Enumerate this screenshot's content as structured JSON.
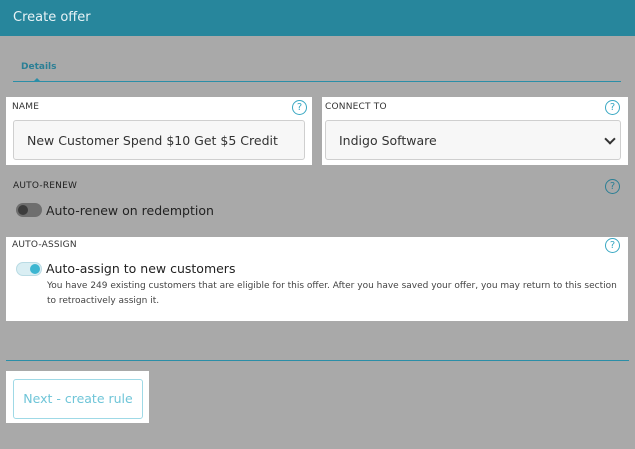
{
  "header": {
    "title": "Create offer"
  },
  "tabs": [
    {
      "label": "Details",
      "active": true
    }
  ],
  "name_section": {
    "label": "NAME",
    "help": "?",
    "value": "New Customer Spend $10 Get $5 Credit"
  },
  "connect_section": {
    "label": "CONNECT TO",
    "help": "?",
    "selected": "Indigo Software"
  },
  "auto_renew": {
    "label": "AUTO-RENEW",
    "help": "?",
    "toggle_label": "Auto-renew on redemption",
    "enabled": false
  },
  "auto_assign": {
    "label": "AUTO-ASSIGN",
    "help": "?",
    "toggle_label": "Auto-assign to new customers",
    "enabled": true,
    "note": "You have 249 existing customers that are eligible for this offer. After you have saved your offer, you may return to this section to retroactively assign it."
  },
  "footer": {
    "next_label": "Next - create rule"
  },
  "colors": {
    "accent": "#27869c",
    "background": "#a9a9a9",
    "toggle_on": "#3db6d1"
  }
}
